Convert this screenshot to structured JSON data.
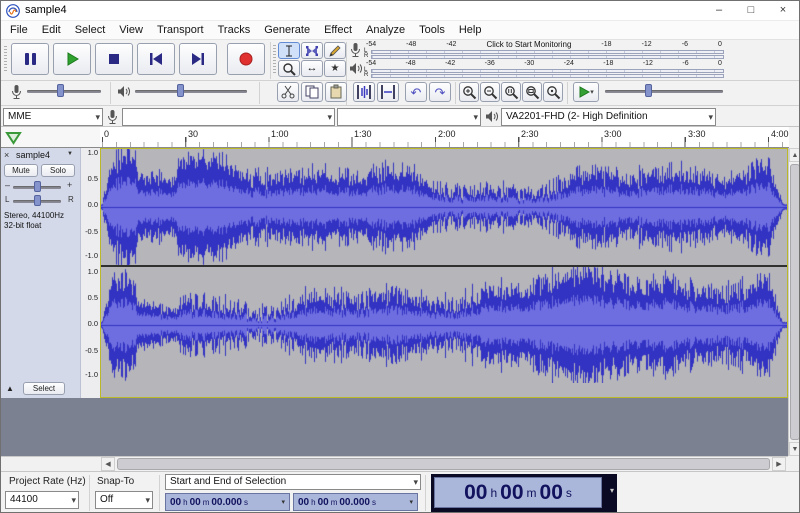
{
  "window": {
    "title": "sample4",
    "minimize": "–",
    "maximize": "□",
    "close": "×"
  },
  "menubar": {
    "items": [
      "File",
      "Edit",
      "Select",
      "View",
      "Transport",
      "Tracks",
      "Generate",
      "Effect",
      "Analyze",
      "Tools",
      "Help"
    ]
  },
  "meters": {
    "record": {
      "l": "L",
      "r": "R",
      "left_labels": [
        "-54",
        "-48",
        "-42"
      ],
      "monitor": "Click to Start Monitoring",
      "right_labels": [
        "-18",
        "-12",
        "-6",
        "0"
      ]
    },
    "play": {
      "l": "L",
      "r": "R",
      "labels": [
        "-54",
        "-48",
        "-42",
        "-36",
        "-30",
        "-24",
        "-18",
        "-12",
        "-6",
        "0"
      ]
    }
  },
  "device": {
    "host": "MME",
    "recording_device": "",
    "recording_channels": "",
    "playback_device": "VA2201-FHD (2- High Definition"
  },
  "ruler": {
    "ticks": [
      "0",
      "30",
      "1:00",
      "1:30",
      "2:00",
      "2:30",
      "3:00",
      "3:30",
      "4:00"
    ]
  },
  "track": {
    "close": "×",
    "name": "sample4",
    "menu_arrow": "▼",
    "mute": "Mute",
    "solo": "Solo",
    "gain_min": "–",
    "gain_max": "+",
    "pan_left": "L",
    "pan_right": "R",
    "info_line1": "Stereo, 44100Hz",
    "info_line2": "32-bit float",
    "collapse": "▲",
    "select_label": "Select",
    "scale": [
      "1.0",
      "0.5",
      "0.0",
      "-0.5",
      "-1.0"
    ]
  },
  "waveform": {
    "color": "#3232c3",
    "inner": "#6e6ee0",
    "bg": "#b6b6ba"
  },
  "bottom": {
    "rate_label": "Project Rate (Hz)",
    "rate_value": "44100",
    "snap_label": "Snap-To",
    "snap_value": "Off",
    "selection_mode": "Start and End of Selection",
    "sel_start": [
      "00",
      "h",
      "00",
      "m",
      "00.000",
      "s"
    ],
    "sel_end": [
      "00",
      "h",
      "00",
      "m",
      "00.000",
      "s"
    ],
    "audio_position": [
      "00",
      "h",
      "00",
      "m",
      "00",
      "s"
    ]
  },
  "icons": {
    "combo_arrow": "▾",
    "undo": "↶",
    "redo": "↷",
    "timeshift": "↔",
    "multi": "★",
    "scroll_up": "▲",
    "scroll_down": "▼",
    "scroll_left": "◀",
    "scroll_right": "▶"
  }
}
